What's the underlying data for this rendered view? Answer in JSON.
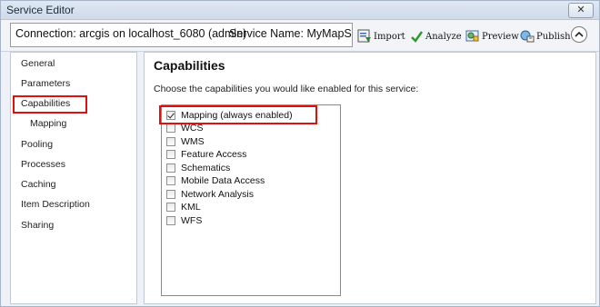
{
  "window": {
    "title": "Service Editor",
    "close_symbol": "✕"
  },
  "toolbar": {
    "connection_text": "Connection: arcgis on localhost_6080 (admin)",
    "service_name_text": "Service Name: MyMapSe...",
    "import_label": "Import",
    "analyze_label": "Analyze",
    "preview_label": "Preview",
    "publish_label": "Publish"
  },
  "nav": {
    "items": [
      {
        "label": "General",
        "selected": false,
        "sub": false
      },
      {
        "label": "Parameters",
        "selected": false,
        "sub": false
      },
      {
        "label": "Capabilities",
        "selected": true,
        "sub": false
      },
      {
        "label": "Mapping",
        "selected": false,
        "sub": true
      },
      {
        "label": "Pooling",
        "selected": false,
        "sub": false
      },
      {
        "label": "Processes",
        "selected": false,
        "sub": false
      },
      {
        "label": "Caching",
        "selected": false,
        "sub": false
      },
      {
        "label": "Item Description",
        "selected": false,
        "sub": false
      },
      {
        "label": "Sharing",
        "selected": false,
        "sub": false
      }
    ]
  },
  "capabilities": {
    "title": "Capabilities",
    "description": "Choose the capabilities you would like enabled for this service:",
    "items": [
      {
        "label": "Mapping (always enabled)",
        "checked": true
      },
      {
        "label": "WCS",
        "checked": false
      },
      {
        "label": "WMS",
        "checked": false
      },
      {
        "label": "Feature Access",
        "checked": false
      },
      {
        "label": "Schematics",
        "checked": false
      },
      {
        "label": "Mobile Data Access",
        "checked": false
      },
      {
        "label": "Network Analysis",
        "checked": false
      },
      {
        "label": "KML",
        "checked": false
      },
      {
        "label": "WFS",
        "checked": false
      }
    ]
  },
  "colors": {
    "highlight": "#e01010",
    "analyze_check": "#2a9a2a"
  }
}
